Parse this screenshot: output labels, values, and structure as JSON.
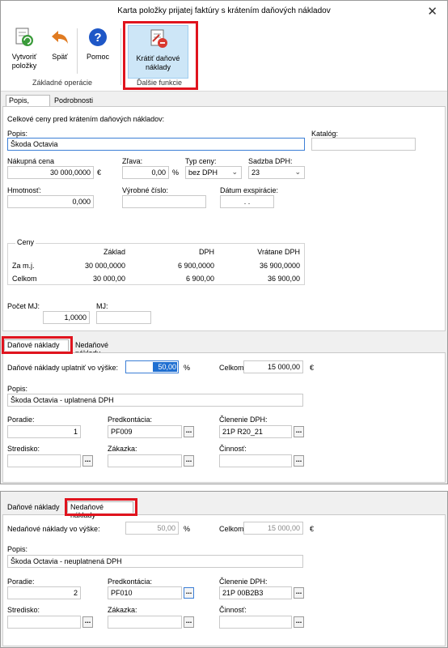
{
  "window": {
    "title": "Karta položky prijatej faktúry s krátením daňových nákladov",
    "close_glyph": "✕"
  },
  "ribbon": {
    "create_label_1": "Vytvoriť",
    "create_label_2": "položky",
    "back_label": "Späť",
    "help_label": "Pomoc",
    "group_basic": "Základné operácie",
    "reduce_label_1": "Krátiť daňové",
    "reduce_label_2": "náklady",
    "group_more": "Ďalšie funkcie",
    "icons": [
      "create-items-icon",
      "back-arrow-icon",
      "help-icon",
      "reduce-costs-icon"
    ]
  },
  "tabs_main": {
    "tab1": "Popis, cena",
    "tab2": "Podrobnosti"
  },
  "form": {
    "section_title": "Celkové ceny pred krátením daňových nákladov:",
    "popis_label": "Popis:",
    "popis_value": "Škoda Octavia",
    "katalog_label": "Katalóg:",
    "katalog_value": "",
    "nakupna_label": "Nákupná cena",
    "nakupna_value": "30 000,0000",
    "currency": "€",
    "zlava_label": "Zľava:",
    "zlava_value": "0,00",
    "percent": "%",
    "typ_label": "Typ ceny:",
    "typ_value": "bez DPH",
    "sadzba_label": "Sadzba DPH:",
    "sadzba_value": "23",
    "hmotnost_label": "Hmotnosť:",
    "hmotnost_value": "0,000",
    "vyrobne_label": "Výrobné číslo:",
    "vyrobne_value": "",
    "datum_label": "Dátum exspirácie:",
    "datum_value": ". .",
    "ceny_legend": "Ceny",
    "ceny_headers": [
      "Základ",
      "DPH",
      "Vrátane DPH"
    ],
    "ceny_rows": [
      {
        "label": "Za m.j.",
        "zaklad": "30 000,0000",
        "dph": "6 900,0000",
        "vratane": "36 900,0000"
      },
      {
        "label": "Celkom",
        "zaklad": "30 000,00",
        "dph": "6 900,00",
        "vratane": "36 900,00"
      }
    ],
    "pocet_label": "Počet MJ:",
    "pocet_value": "1,0000",
    "mj_label": "MJ:",
    "mj_value": ""
  },
  "tabs_cost": {
    "tab1": "Daňové náklady",
    "tab2": "Nedaňové náklady"
  },
  "danove": {
    "uplatnit_label": "Daňové náklady uplatniť vo výške:",
    "uplatnit_value": "50,00",
    "percent": "%",
    "celkom_label": "Celkom:",
    "celkom_value": "15 000,00",
    "currency": "€",
    "popis_label": "Popis:",
    "popis_value": "Škoda Octavia - uplatnená DPH",
    "poradie_label": "Poradie:",
    "poradie_value": "1",
    "predkontacia_label": "Predkontácia:",
    "predkontacia_value": "PF009",
    "clenenie_label": "Členenie DPH:",
    "clenenie_value": "21P R20_21",
    "stredisko_label": "Stredisko:",
    "zakazka_label": "Zákazka:",
    "cinnost_label": "Činnosť:",
    "dots": "..."
  },
  "nedanove": {
    "tab1": "Daňové náklady",
    "tab2": "Nedaňové náklady",
    "label": "Nedaňové náklady vo výške:",
    "value": "50,00",
    "percent": "%",
    "celkom_label": "Celkom:",
    "celkom_value": "15 000,00",
    "currency": "€",
    "popis_label": "Popis:",
    "popis_value": "Škoda Octavia - neuplatnená DPH",
    "poradie_label": "Poradie:",
    "poradie_value": "2",
    "predkontacia_label": "Predkontácia:",
    "predkontacia_value": "PF010",
    "clenenie_label": "Členenie DPH:",
    "clenenie_value": "21P 00B2B3",
    "stredisko_label": "Stredisko:",
    "zakazka_label": "Zákazka:",
    "cinnost_label": "Činnosť:",
    "dots": "..."
  },
  "colors": {
    "highlight": "#e0141e",
    "focus": "#3c7fd6",
    "selection": "#1f6fd1"
  }
}
